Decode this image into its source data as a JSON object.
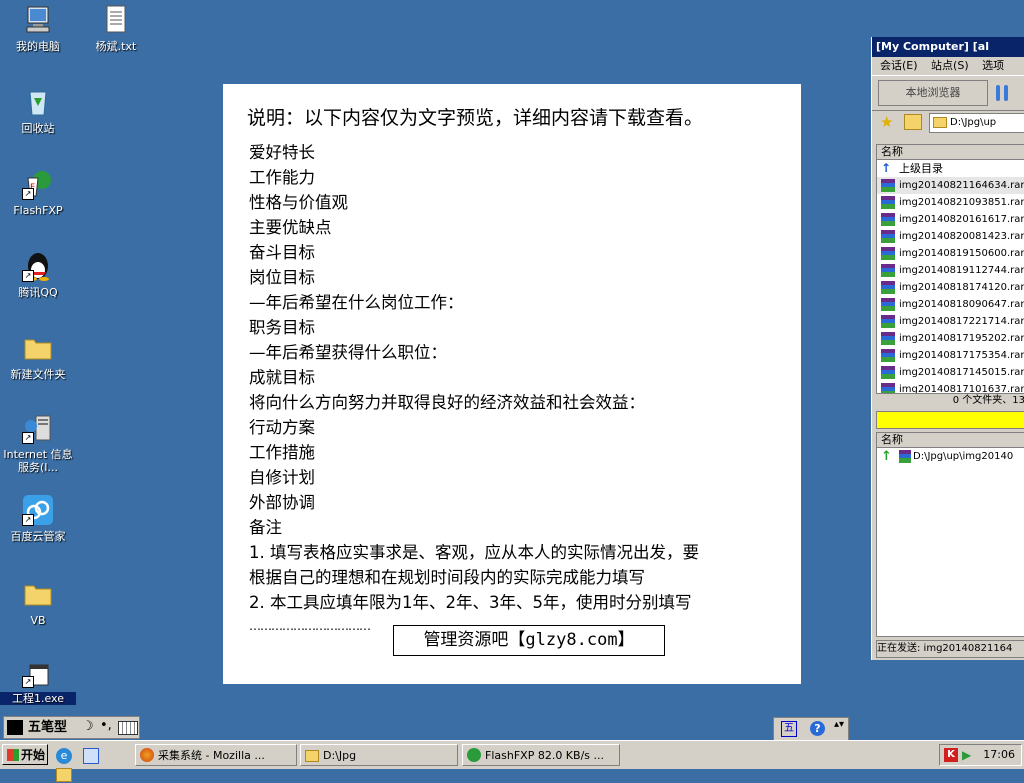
{
  "desktop": {
    "icons": [
      {
        "label": "我的电脑"
      },
      {
        "label": "杨斌.txt"
      },
      {
        "label": "回收站"
      },
      {
        "label": "FlashFXP"
      },
      {
        "label": "腾讯QQ"
      },
      {
        "label": "新建文件夹"
      },
      {
        "label": "Internet 信息服务(I..."
      },
      {
        "label": "百度云管家"
      },
      {
        "label": "VB"
      },
      {
        "label": "工程1.exe"
      }
    ]
  },
  "preview": {
    "title": "说明：以下内容仅为文字预览，详细内容请下载查看。",
    "lines": [
      "爱好特长",
      "工作能力",
      "性格与价值观",
      "主要优缺点",
      "奋斗目标",
      "岗位目标",
      "—年后希望在什么岗位工作：",
      "职务目标",
      "—年后希望获得什么职位：",
      "成就目标",
      "将向什么方向努力并取得良好的经济效益和社会效益：",
      "行动方案",
      "工作措施",
      "自修计划",
      "外部协调",
      "备注",
      "1. 填写表格应实事求是、客观，应从本人的实际情况出发，要",
      "根据自己的理想和在规划时间段内的实际完成能力填写",
      "2. 本工具应填年限为1年、2年、3年、5年，使用时分别填写"
    ],
    "ellipsis": "……………………………",
    "banner": "管理资源吧【glzy8.com】"
  },
  "flashfxp": {
    "title": "[My Computer]  [al",
    "menu": [
      "会话(E)",
      "站点(S)",
      "选项"
    ],
    "local_browser": "本地浏览器",
    "path": "D:\\Jpg\\up",
    "col_name": "名称",
    "parent_dir": "上级目录",
    "files": [
      "img20140821164634.rar",
      "img20140821093851.rar",
      "img20140820161617.rar",
      "img20140820081423.rar",
      "img20140819150600.rar",
      "img20140819112744.rar",
      "img20140818174120.rar",
      "img20140818090647.rar",
      "img20140817221714.rar",
      "img20140817195202.rar",
      "img20140817175354.rar",
      "img20140817145015.rar",
      "img20140817101637.rar"
    ],
    "status": "0 个文件夹、13",
    "queue_col": "名称",
    "queue_item": "D:\\Jpg\\up\\img20140",
    "sending": "正在发送: img20140821164"
  },
  "langbar": {
    "label": "五笔型"
  },
  "taskbar": {
    "start": "开始",
    "tasks": [
      "采集系统 - Mozilla ...",
      "D:\\Jpg",
      "FlashFXP 82.0 KB/s ..."
    ],
    "clock": "17:06"
  },
  "colors": {
    "desktop": "#3a6ea5",
    "title_bar": "#0a246a",
    "progress": "#ffff00"
  }
}
